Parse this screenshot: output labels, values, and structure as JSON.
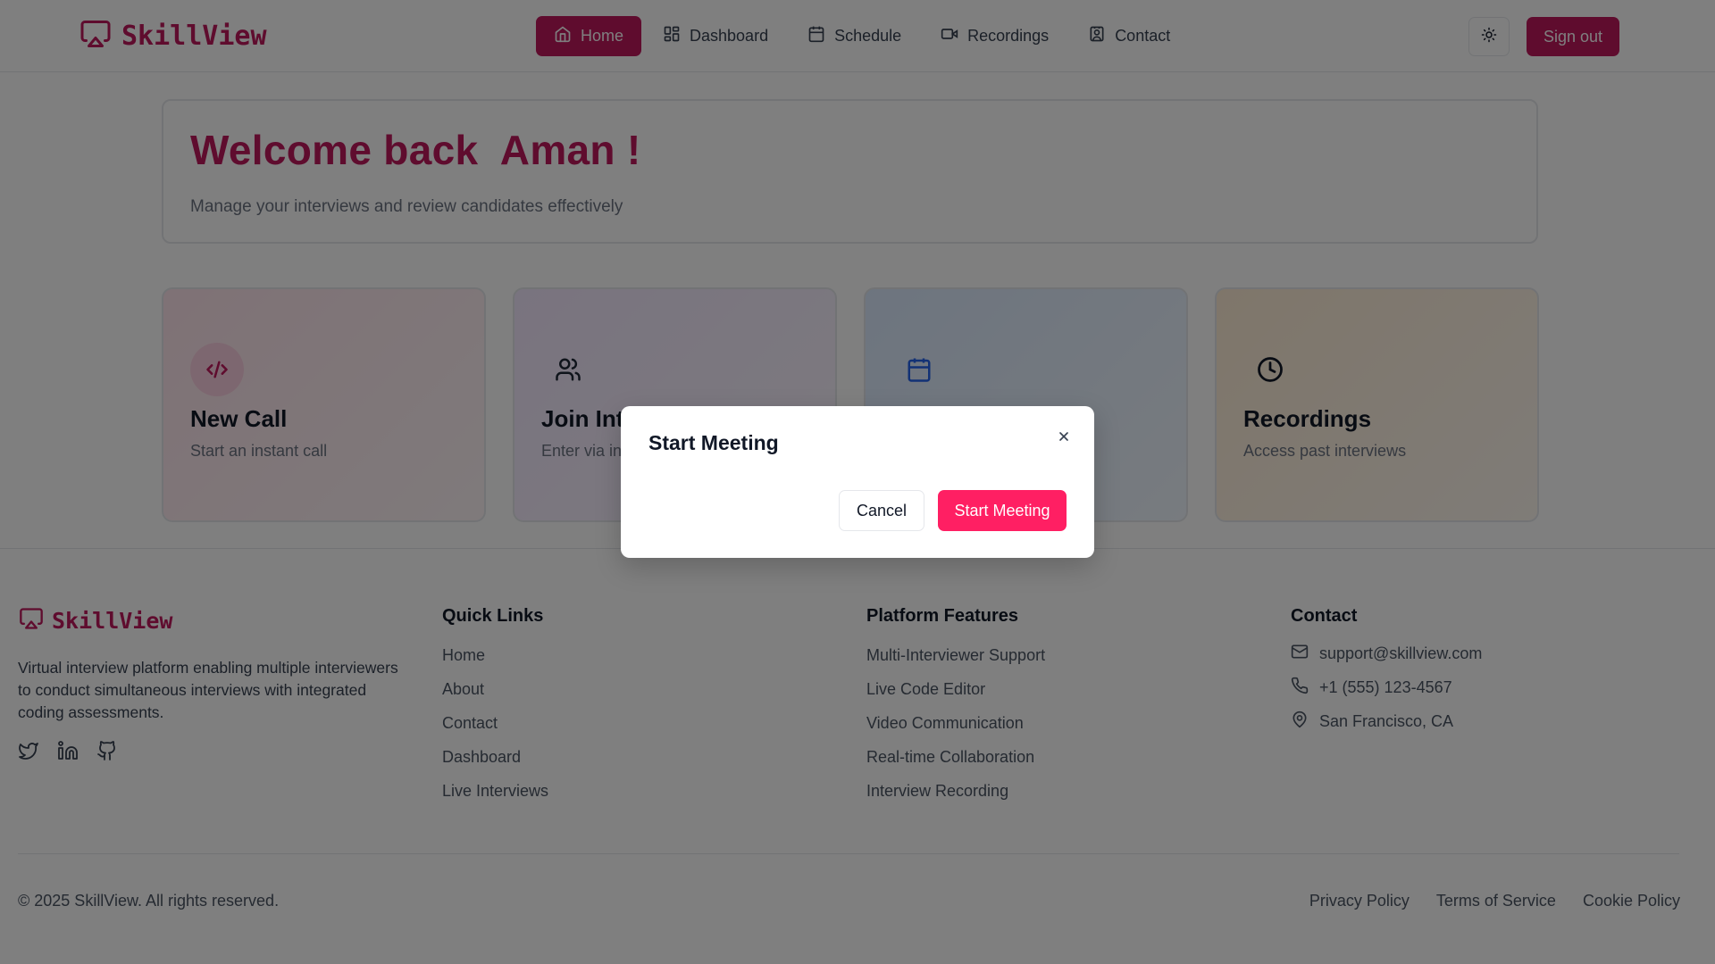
{
  "app": {
    "name": "SkillView"
  },
  "nav": {
    "items": [
      {
        "label": "Home",
        "icon": "home-icon",
        "active": true
      },
      {
        "label": "Dashboard",
        "icon": "dashboard-icon",
        "active": false
      },
      {
        "label": "Schedule",
        "icon": "calendar-icon",
        "active": false
      },
      {
        "label": "Recordings",
        "icon": "video-icon",
        "active": false
      },
      {
        "label": "Contact",
        "icon": "contact-icon",
        "active": false
      }
    ],
    "sign_out_label": "Sign out",
    "theme_toggle_icon": "sun-icon"
  },
  "welcome": {
    "title": "Welcome back  Aman !",
    "subtitle": "Manage your interviews and review candidates effectively"
  },
  "cards": [
    {
      "title": "New Call",
      "subtitle": "Start an instant call",
      "icon": "code-icon"
    },
    {
      "title": "Join Int",
      "subtitle": "Enter via in",
      "icon": "users-icon"
    },
    {
      "title": "",
      "subtitle": "",
      "icon": "calendar-icon"
    },
    {
      "title": "Recordings",
      "subtitle": "Access past interviews",
      "icon": "clock-icon"
    }
  ],
  "footer": {
    "brand": "SkillView",
    "description": "Virtual interview platform enabling multiple interviewers to conduct simultaneous interviews with integrated coding assessments.",
    "social": [
      "twitter-icon",
      "linkedin-icon",
      "github-icon"
    ],
    "quick_links": {
      "heading": "Quick Links",
      "items": [
        "Home",
        "About",
        "Contact",
        "Dashboard",
        "Live Interviews"
      ]
    },
    "features": {
      "heading": "Platform Features",
      "items": [
        "Multi-Interviewer Support",
        "Live Code Editor",
        "Video Communication",
        "Real-time Collaboration",
        "Interview Recording"
      ]
    },
    "contact": {
      "heading": "Contact",
      "email": "support@skillview.com",
      "phone": "+1 (555) 123-4567",
      "location": "San Francisco, CA"
    },
    "copyright": "© 2025 SkillView. All rights reserved.",
    "legal": [
      "Privacy Policy",
      "Terms of Service",
      "Cookie Policy"
    ]
  },
  "modal": {
    "title": "Start Meeting",
    "cancel_label": "Cancel",
    "start_label": "Start Meeting"
  },
  "colors": {
    "brand": "#be185d",
    "start_button": "#ff1f63"
  }
}
